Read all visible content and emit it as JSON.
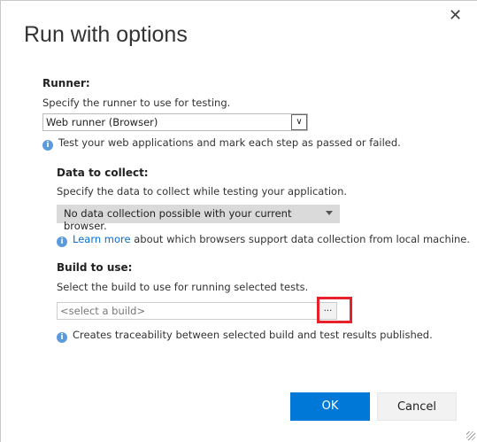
{
  "dialog": {
    "title": "Run with options",
    "close_icon": "close-icon"
  },
  "runner": {
    "label": "Runner:",
    "description": "Specify the runner to use for testing.",
    "selected": "Web runner (Browser)",
    "info": "Test your web applications and mark each step as passed or failed."
  },
  "data_collect": {
    "label": "Data to collect:",
    "description": "Specify the data to collect while testing your application.",
    "selected": "No data collection possible with your current browser.",
    "info_link": "Learn more",
    "info_rest": " about which browsers support data collection from local machine."
  },
  "build": {
    "label": "Build to use:",
    "description": "Select the build to use for running selected tests.",
    "placeholder": "<select a build>",
    "browse_label": "...",
    "info": "Creates traceability between selected build and test results published."
  },
  "buttons": {
    "ok": "OK",
    "cancel": "Cancel"
  },
  "colors": {
    "accent": "#0078d7",
    "highlight": "#e8202a"
  }
}
